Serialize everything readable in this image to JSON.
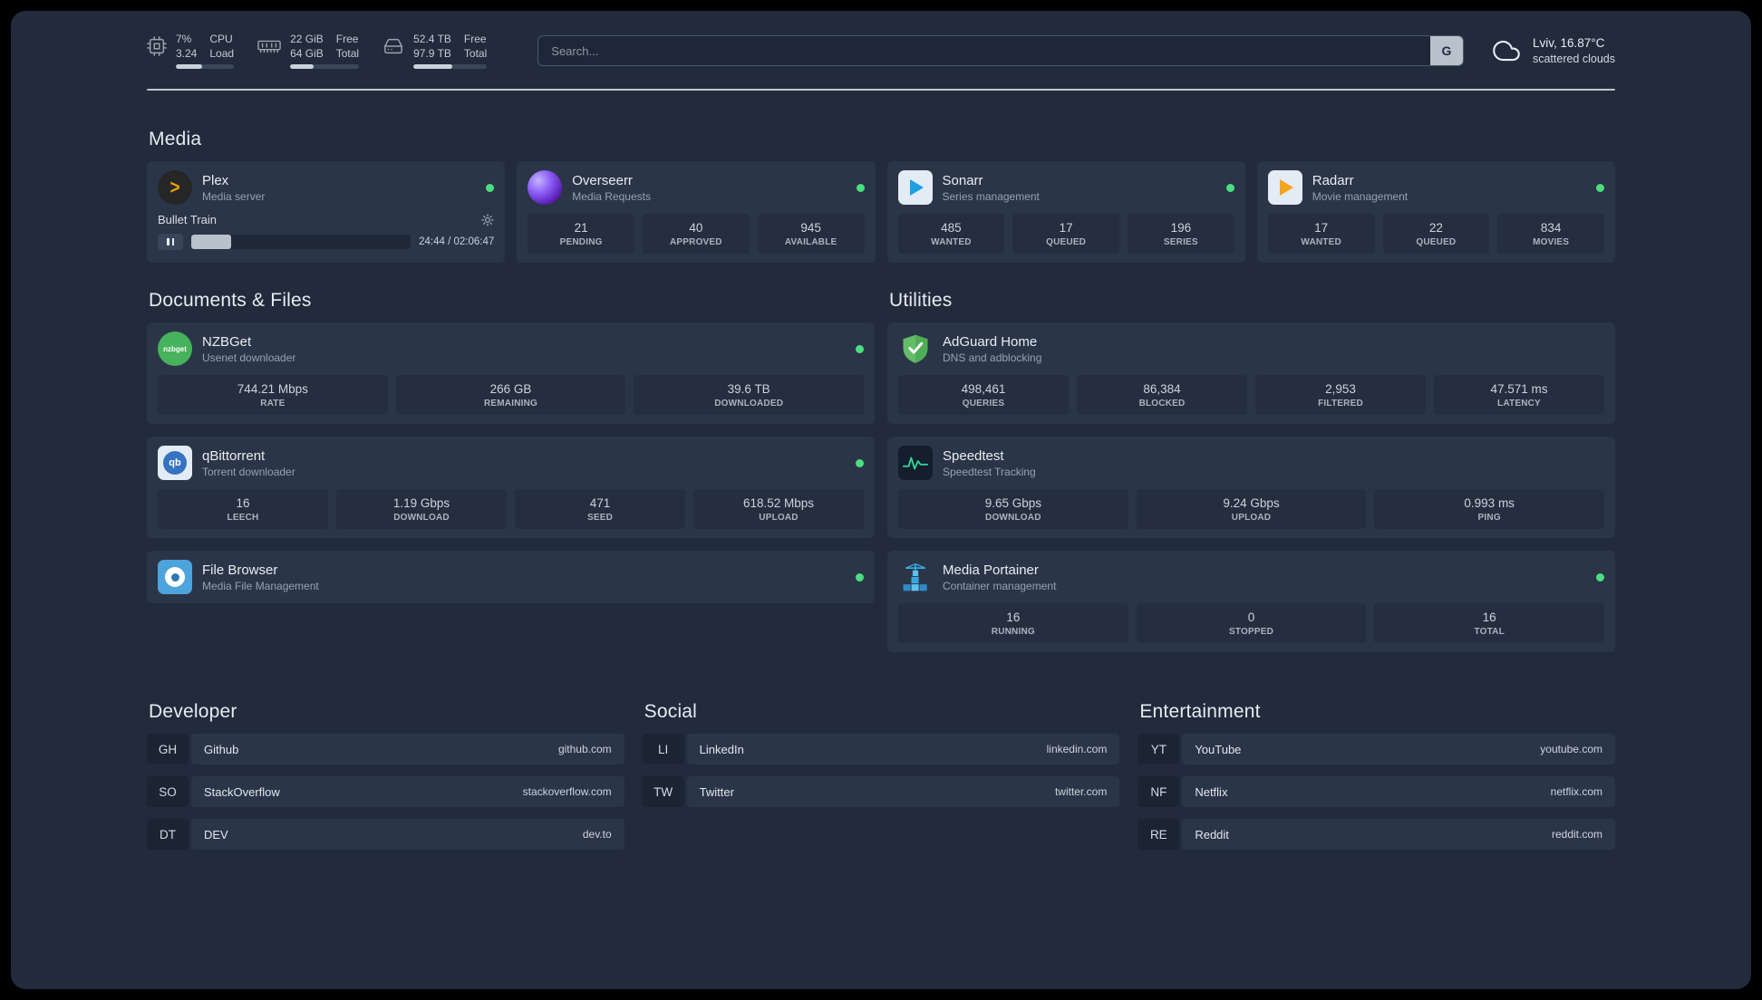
{
  "topbar": {
    "cpu": {
      "values": [
        "7%",
        "3.24"
      ],
      "labels": [
        "CPU",
        "Load"
      ],
      "progress": 45
    },
    "ram": {
      "values": [
        "22 GiB",
        "64 GiB"
      ],
      "labels": [
        "Free",
        "Total"
      ],
      "progress": 34
    },
    "disk": {
      "values": [
        "52.4 TB",
        "97.9 TB"
      ],
      "labels": [
        "Free",
        "Total"
      ],
      "progress": 53
    },
    "search": {
      "placeholder": "Search...",
      "button_label": "G"
    },
    "weather": {
      "location": "Lviv, 16.87°C",
      "condition": "scattered clouds"
    }
  },
  "sections": {
    "media": {
      "title": "Media"
    },
    "documents": {
      "title": "Documents & Files"
    },
    "utilities": {
      "title": "Utilities"
    },
    "developer": {
      "title": "Developer"
    },
    "social": {
      "title": "Social"
    },
    "entertainment": {
      "title": "Entertainment"
    }
  },
  "apps": {
    "plex": {
      "name": "Plex",
      "subtitle": "Media server",
      "player": {
        "track": "Bullet Train",
        "time": "24:44 / 02:06:47",
        "progress_percent": 18
      }
    },
    "overseerr": {
      "name": "Overseerr",
      "subtitle": "Media Requests",
      "stats": [
        {
          "value": "21",
          "label": "PENDING"
        },
        {
          "value": "40",
          "label": "APPROVED"
        },
        {
          "value": "945",
          "label": "AVAILABLE"
        }
      ]
    },
    "sonarr": {
      "name": "Sonarr",
      "subtitle": "Series management",
      "stats": [
        {
          "value": "485",
          "label": "WANTED"
        },
        {
          "value": "17",
          "label": "QUEUED"
        },
        {
          "value": "196",
          "label": "SERIES"
        }
      ]
    },
    "radarr": {
      "name": "Radarr",
      "subtitle": "Movie management",
      "stats": [
        {
          "value": "17",
          "label": "WANTED"
        },
        {
          "value": "22",
          "label": "QUEUED"
        },
        {
          "value": "834",
          "label": "MOVIES"
        }
      ]
    },
    "nzbget": {
      "name": "NZBGet",
      "subtitle": "Usenet downloader",
      "stats": [
        {
          "value": "744.21 Mbps",
          "label": "RATE"
        },
        {
          "value": "266 GB",
          "label": "REMAINING"
        },
        {
          "value": "39.6 TB",
          "label": "DOWNLOADED"
        }
      ]
    },
    "qbittorrent": {
      "name": "qBittorrent",
      "subtitle": "Torrent downloader",
      "stats": [
        {
          "value": "16",
          "label": "LEECH"
        },
        {
          "value": "1.19 Gbps",
          "label": "DOWNLOAD"
        },
        {
          "value": "471",
          "label": "SEED"
        },
        {
          "value": "618.52 Mbps",
          "label": "UPLOAD"
        }
      ]
    },
    "filebrowser": {
      "name": "File Browser",
      "subtitle": "Media File Management"
    },
    "adguard": {
      "name": "AdGuard Home",
      "subtitle": "DNS and adblocking",
      "stats": [
        {
          "value": "498,461",
          "label": "QUERIES"
        },
        {
          "value": "86,384",
          "label": "BLOCKED"
        },
        {
          "value": "2,953",
          "label": "FILTERED"
        },
        {
          "value": "47.571 ms",
          "label": "LATENCY"
        }
      ]
    },
    "speedtest": {
      "name": "Speedtest",
      "subtitle": "Speedtest Tracking",
      "stats": [
        {
          "value": "9.65 Gbps",
          "label": "DOWNLOAD"
        },
        {
          "value": "9.24 Gbps",
          "label": "UPLOAD"
        },
        {
          "value": "0.993 ms",
          "label": "PING"
        }
      ]
    },
    "portainer": {
      "name": "Media Portainer",
      "subtitle": "Container management",
      "stats": [
        {
          "value": "16",
          "label": "RUNNING"
        },
        {
          "value": "0",
          "label": "STOPPED"
        },
        {
          "value": "16",
          "label": "TOTAL"
        }
      ]
    }
  },
  "bookmarks": {
    "developer": [
      {
        "abbr": "GH",
        "name": "Github",
        "url": "github.com"
      },
      {
        "abbr": "SO",
        "name": "StackOverflow",
        "url": "stackoverflow.com"
      },
      {
        "abbr": "DT",
        "name": "DEV",
        "url": "dev.to"
      }
    ],
    "social": [
      {
        "abbr": "LI",
        "name": "LinkedIn",
        "url": "linkedin.com"
      },
      {
        "abbr": "TW",
        "name": "Twitter",
        "url": "twitter.com"
      }
    ],
    "entertainment": [
      {
        "abbr": "YT",
        "name": "YouTube",
        "url": "youtube.com"
      },
      {
        "abbr": "NF",
        "name": "Netflix",
        "url": "netflix.com"
      },
      {
        "abbr": "RE",
        "name": "Reddit",
        "url": "reddit.com"
      }
    ]
  },
  "colors": {
    "status_online": "#4ade80",
    "plex_accent": "#e5a00d",
    "overseerr_purple": "#8b5cf6",
    "sonarr_blue": "#1e9fe0",
    "radarr_amber": "#f2a51c",
    "nzbget_green": "#46b25b",
    "qbittorrent_blue": "#3573c0",
    "adguard_green": "#63bd68",
    "speedtest_green": "#34d399",
    "portainer_blue": "#36a7e0",
    "filebrowser_blue": "#4da3dc"
  }
}
